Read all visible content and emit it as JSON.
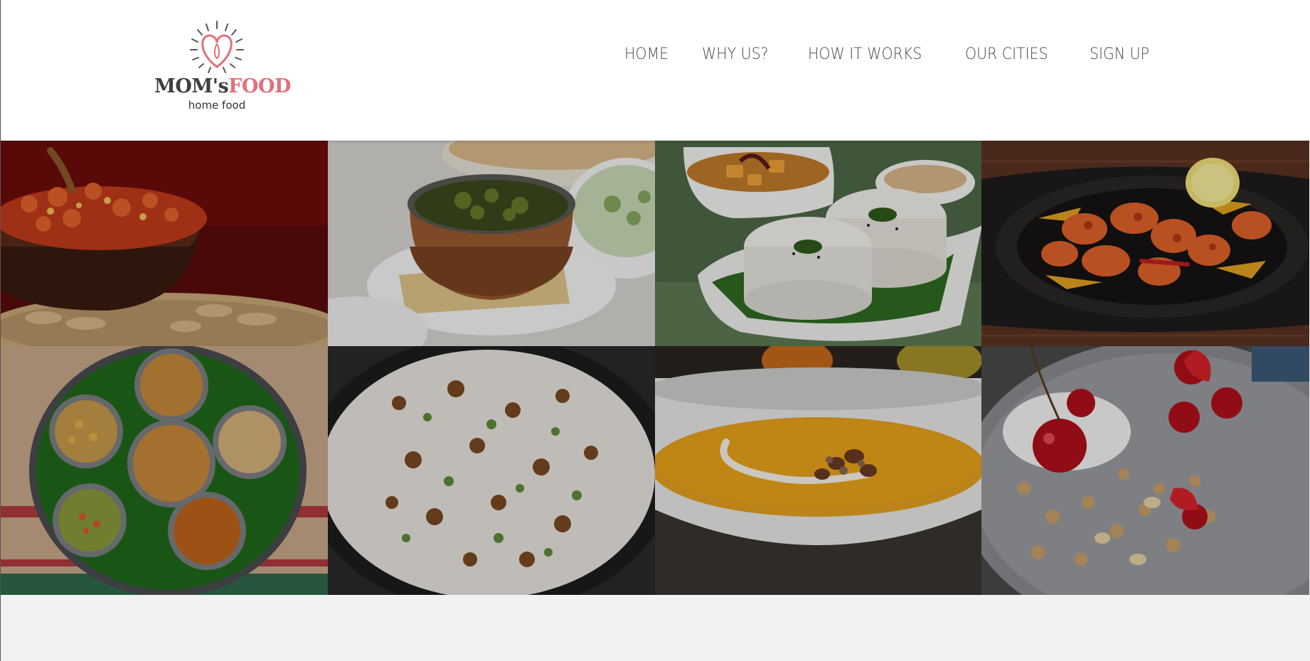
{
  "brand": {
    "logo_word_1": "MOM's",
    "logo_word_2": "FOOD",
    "logo_tagline": "home food",
    "colors": {
      "brand_red": "#e2707b",
      "text_dark": "#3f3f3f",
      "nav_text": "#4a4a4a",
      "page_bg": "#f2f2f2",
      "header_bg": "#ffffff"
    }
  },
  "nav": {
    "items": [
      {
        "label": "HOME"
      },
      {
        "label": "WHY US?"
      },
      {
        "label": "HOW IT WORKS"
      },
      {
        "label": "OUR CITIES"
      },
      {
        "label": "SIGN UP"
      }
    ]
  },
  "gallery": {
    "tiles": [
      {
        "subject": "red-curry-bowl-image"
      },
      {
        "subject": "saag-in-copper-pot-image"
      },
      {
        "subject": "idli-sambar-image"
      },
      {
        "subject": "sizzling-chicken-tikka-image"
      },
      {
        "subject": "thali-platter-image"
      },
      {
        "subject": "biryani-pan-image"
      },
      {
        "subject": "pumpkin-soup-image"
      },
      {
        "subject": "granola-cherries-image"
      }
    ]
  }
}
